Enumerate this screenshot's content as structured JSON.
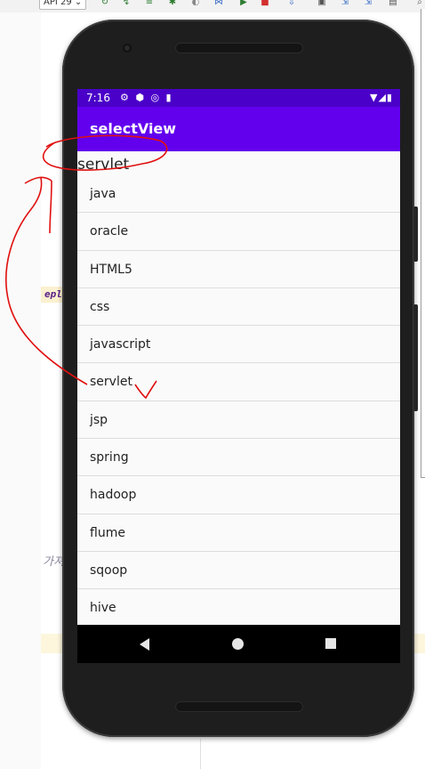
{
  "ide": {
    "api_label": "API 29",
    "code_fragment": "eple",
    "korean_fragment": "가져"
  },
  "device": {
    "status_time": "7:16",
    "status_icons": "⚙ ⬢ ◎ ▮",
    "status_right": "▼◢▮"
  },
  "app": {
    "title": "selectView",
    "selected_value": "servlet",
    "items": [
      "java",
      "oracle",
      "HTML5",
      "css",
      "javascript",
      "servlet",
      "jsp",
      "spring",
      "hadoop",
      "flume",
      "sqoop",
      "hive"
    ]
  },
  "colors": {
    "status_bar": "#4a00c8",
    "app_bar": "#6200ee",
    "annotation": "#e01010"
  },
  "icons": {
    "nav_back": "back-triangle",
    "nav_home": "home-circle",
    "nav_recents": "recents-square"
  }
}
